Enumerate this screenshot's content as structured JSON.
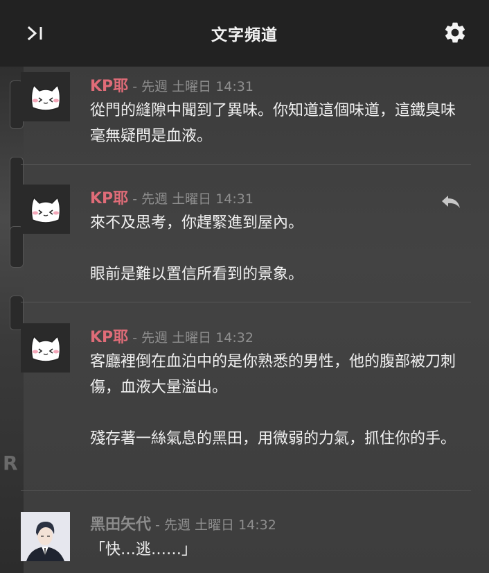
{
  "header": {
    "title": "文字頻道",
    "collapse_icon": "panel-collapse-icon",
    "settings_icon": "gear-icon"
  },
  "colors": {
    "header_bg": "#222222",
    "kp_name": "#e06c78",
    "kuroda_name": "#8c8c8c"
  },
  "messages": [
    {
      "author": "KP耶",
      "timestamp": " - 先週 土曜日 14:31",
      "paragraphs": [
        "從門的縫隙中聞到了異味。你知道這個味道，這鐵臭味毫無疑問是血液。"
      ]
    },
    {
      "author": "KP耶",
      "timestamp": " - 先週 土曜日 14:31",
      "reply_icon": "reply-icon",
      "paragraphs": [
        "來不及思考，你趕緊進到屋內。",
        "眼前是難以置信所看到的景象。"
      ]
    },
    {
      "author": "KP耶",
      "timestamp": " - 先週 土曜日 14:32",
      "paragraphs": [
        "客廳裡倒在血泊中的是你熟悉的男性，他的腹部被刀刺傷，血液大量溢出。",
        "殘存著一絲氣息的黑田，用微弱的力氣，抓住你的手。"
      ]
    },
    {
      "author": "黑田矢代",
      "timestamp": " - 先週 土曜日 14:32",
      "paragraphs": [
        "「快…逃……」"
      ]
    }
  ]
}
